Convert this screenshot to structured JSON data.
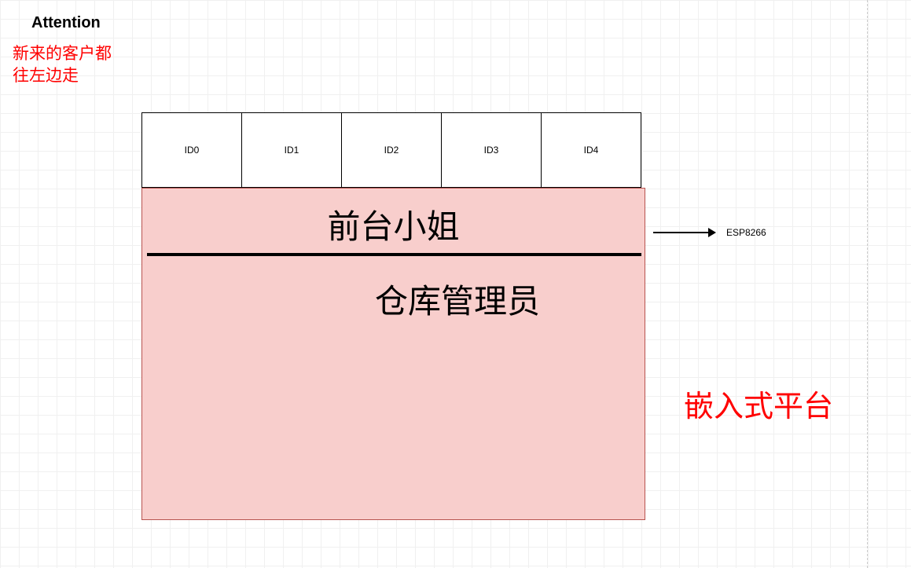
{
  "header": {
    "attention_title": "Attention",
    "attention_note_line1": "新来的客户都",
    "attention_note_line2": "往左边走"
  },
  "id_boxes": [
    "ID0",
    "ID1",
    "ID2",
    "ID3",
    "ID4"
  ],
  "labels": {
    "front_desk": "前台小姐",
    "warehouse": "仓库管理员",
    "esp": "ESP8266",
    "platform": "嵌入式平台"
  }
}
